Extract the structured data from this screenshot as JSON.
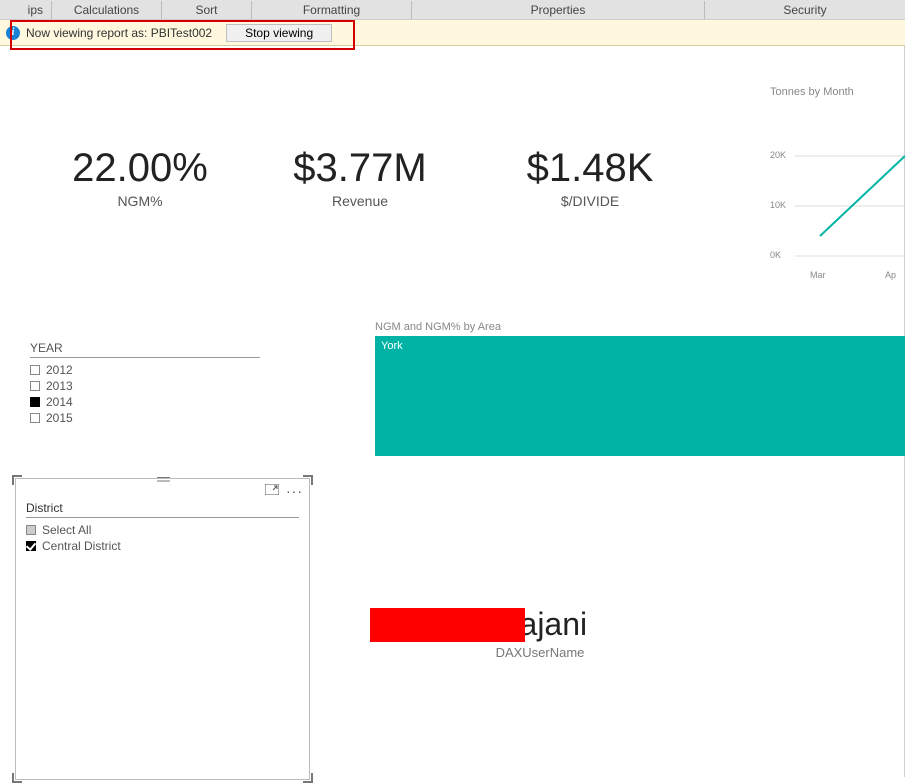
{
  "ribbon": {
    "ips": "ips",
    "calculations": "Calculations",
    "sort": "Sort",
    "formatting": "Formatting",
    "properties": "Properties",
    "security": "Security"
  },
  "infobar": {
    "text": "Now viewing report as: PBITest002",
    "stop": "Stop viewing"
  },
  "kpi": [
    {
      "value": "22.00%",
      "label": "NGM%"
    },
    {
      "value": "$3.77M",
      "label": "Revenue"
    },
    {
      "value": "$1.48K",
      "label": "$/DIVIDE"
    }
  ],
  "linechart_title": "Tonnes by Month",
  "chart_data": {
    "type": "line",
    "title": "Tonnes by Month",
    "xlabel": "",
    "ylabel": "",
    "ylim": [
      0,
      20000
    ],
    "yticks": [
      "0K",
      "10K",
      "20K"
    ],
    "categories": [
      "Mar",
      "Apr"
    ],
    "series": [
      {
        "name": "Tonnes",
        "values": [
          4000,
          20000
        ]
      }
    ]
  },
  "year_slicer": {
    "title": "YEAR",
    "items": [
      {
        "label": "2012",
        "checked": false
      },
      {
        "label": "2013",
        "checked": false
      },
      {
        "label": "2014",
        "checked": true
      },
      {
        "label": "2015",
        "checked": false
      }
    ]
  },
  "district_slicer": {
    "title": "District",
    "items": [
      {
        "label": "Select All",
        "state": "indeterminate"
      },
      {
        "label": "Central District",
        "state": "checked"
      }
    ]
  },
  "area_chart": {
    "title": "NGM and NGM% by Area",
    "label": "York"
  },
  "user_card": {
    "value_visible": "krajani",
    "label": "DAXUserName"
  }
}
